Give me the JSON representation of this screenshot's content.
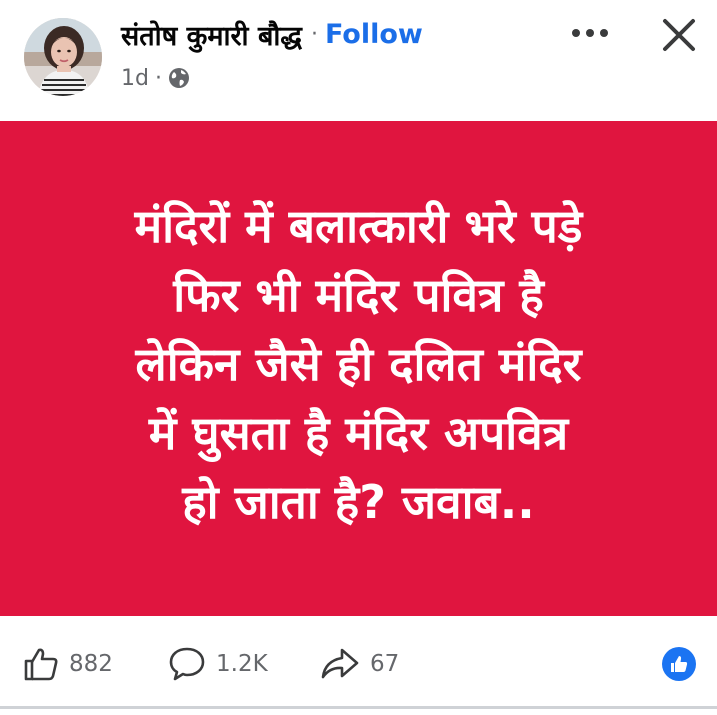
{
  "header": {
    "author_name": "संतोष कुमारी बौद्ध",
    "separator": "·",
    "follow_label": "Follow",
    "timestamp": "1d",
    "meta_separator": "·",
    "privacy_icon": "globe-icon",
    "more_icon": "more-options-icon",
    "close_icon": "close-icon"
  },
  "post_image": {
    "background_color": "#e0153f",
    "lines": [
      "मंदिरों में बलात्कारी भरे पड़े",
      "फिर भी मंदिर पवित्र है",
      "लेकिन जैसे ही दलित मंदिर",
      "में घुसता है मंदिर अपवित्र",
      "हो जाता है? जवाब.."
    ]
  },
  "footer": {
    "like_count": "882",
    "comment_count": "1.2K",
    "share_count": "67",
    "like_icon": "thumbs-up-icon",
    "comment_icon": "comment-icon",
    "share_icon": "share-icon",
    "reaction_icon": "like-reaction-icon",
    "reaction_color": "#1b74f2"
  }
}
